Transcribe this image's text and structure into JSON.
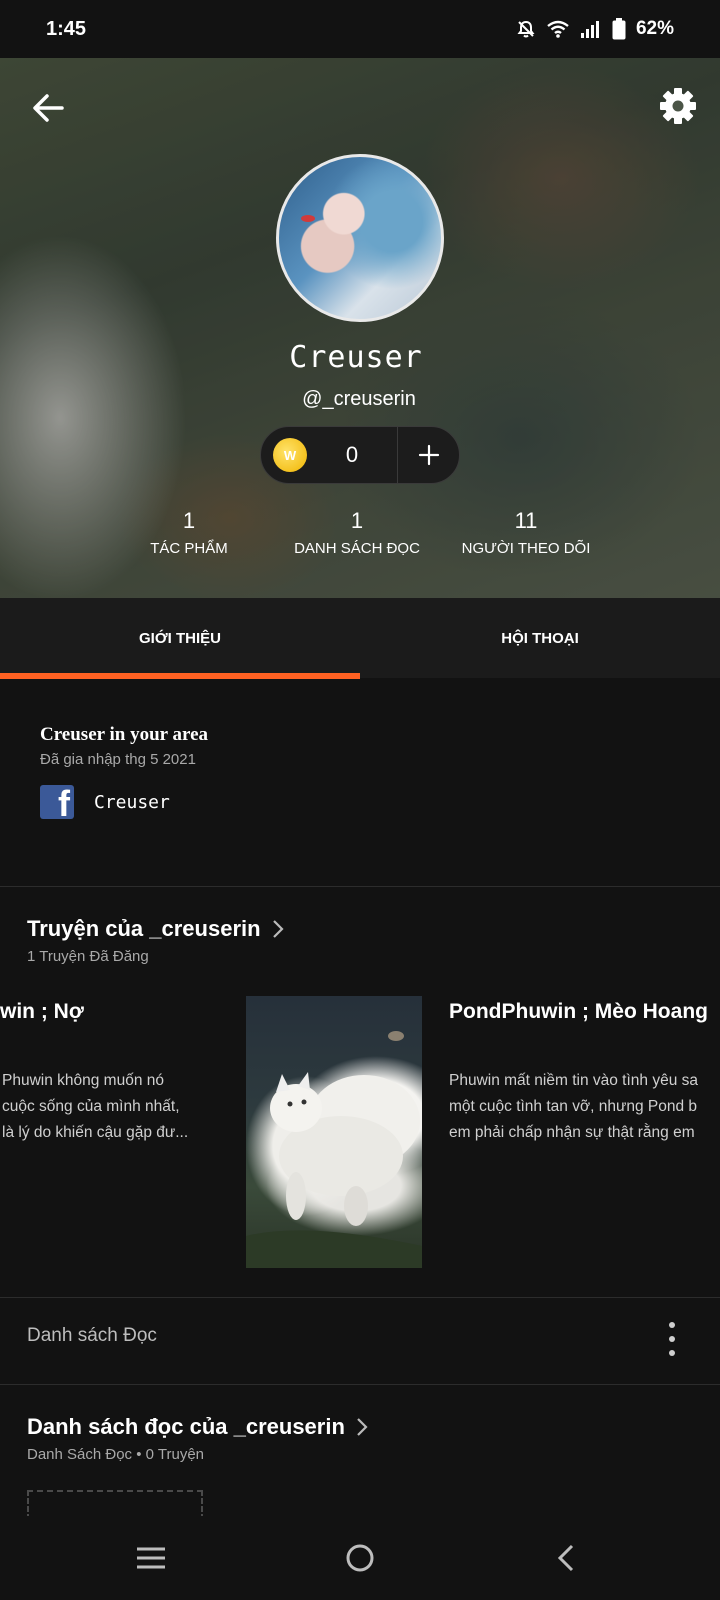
{
  "status": {
    "time": "1:45",
    "battery": "62%"
  },
  "profile": {
    "name": "Creuser",
    "handle": "@_creuserin",
    "coins": "0",
    "stats": [
      {
        "value": "1",
        "label": "TÁC PHẨM"
      },
      {
        "value": "1",
        "label": "DANH SÁCH ĐỌC"
      },
      {
        "value": "11",
        "label": "NGƯỜI THEO DÕI"
      }
    ]
  },
  "tabs": [
    {
      "label": "GIỚI THIỆU",
      "active": true
    },
    {
      "label": "HỘI THOẠI",
      "active": false
    }
  ],
  "about": {
    "title": "Creuser in your area",
    "joined": "Đã gia nhập thg 5 2021",
    "facebook_name": "Creuser"
  },
  "stories_section": {
    "title": "Truyện của _creuserin",
    "subtitle": "1 Truyện Đã Đăng",
    "left_card": {
      "title": "win ; Nợ",
      "desc": [
        "Phuwin không muốn nó",
        "cuộc sống của mình nhất,",
        "là lý do khiến cậu gặp đư..."
      ]
    },
    "right_card": {
      "title": "PondPhuwin ; Mèo Hoang",
      "desc": [
        "Phuwin mất niềm tin vào tình yêu sa",
        "một cuộc tình tan vỡ, nhưng Pond b",
        "em phải chấp nhận sự thật rằng em"
      ]
    }
  },
  "reading_list_row": {
    "label": "Danh sách Đọc"
  },
  "reading_section": {
    "title": "Danh sách đọc của _creuserin",
    "subtitle": "Danh Sách Đọc • 0 Truyện"
  },
  "colors": {
    "accent": "#ff6122",
    "background": "#121212",
    "facebook": "#3b5998"
  },
  "icons": {
    "back": "back-arrow-icon",
    "settings": "gear-icon",
    "coin": "coin-icon",
    "add": "plus-icon",
    "facebook": "facebook-icon",
    "chevron": "chevron-right-icon",
    "more": "kebab-icon"
  }
}
